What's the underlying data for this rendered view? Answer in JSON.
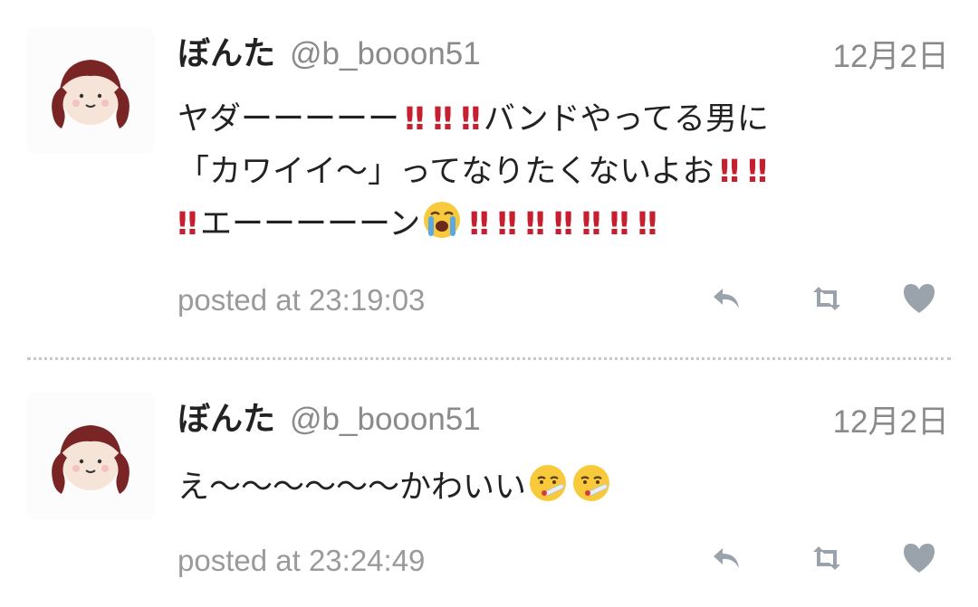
{
  "tweets": [
    {
      "display_name": "ぼんた",
      "screen_name": "@b_booon51",
      "date": "12月2日",
      "text_lines": [
        [
          "ヤダーーーーー",
          "‼",
          "‼",
          "‼",
          "バンドやってる男に"
        ],
        [
          "「カワイイ〜」ってなりたくないよお",
          "‼",
          "‼"
        ],
        [
          "‼",
          "エーーーーーン",
          "😭",
          "‼",
          "‼",
          "‼",
          "‼",
          "‼",
          "‼",
          "‼"
        ]
      ],
      "text": {
        "l1_a": "ヤダーーーーー",
        "l1_b": "バンドやってる男に",
        "l2_a": "「カワイイ〜」ってなりたくないよお",
        "l3_a": "エーーーーーン",
        "bang": "‼"
      },
      "posted": "posted at 23:19:03",
      "emoji": "loudly-crying-face"
    },
    {
      "display_name": "ぼんた",
      "screen_name": "@b_booon51",
      "date": "12月2日",
      "text": {
        "l1_a": "え〜〜〜〜〜〜かわいい"
      },
      "posted": "posted at 23:24:49",
      "emoji": "face-with-thermometer"
    }
  ],
  "icons": {
    "reply": "reply-arrow-icon",
    "retweet": "retweet-icon",
    "favorite": "heart-icon"
  },
  "colors": {
    "accent_red": "#c62030",
    "meta_gray": "#8a8a8a",
    "icon_gray": "#9aa3ab"
  }
}
